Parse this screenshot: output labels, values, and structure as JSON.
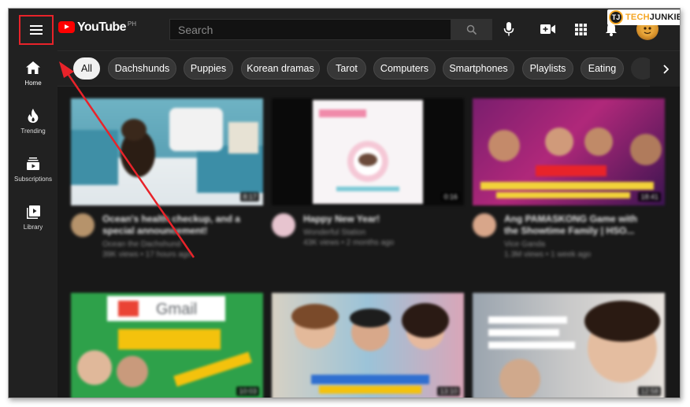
{
  "colors": {
    "accent_red": "#e8232a",
    "youtube_red": "#ff0000",
    "chip_selected_bg": "#f1f1f1",
    "watermark_orange": "#f5a623"
  },
  "header": {
    "logo_text": "YouTube",
    "logo_country": "PH",
    "search_placeholder": "Search",
    "icons": [
      "menu-icon",
      "search-icon",
      "mic-icon",
      "create-video-icon",
      "apps-grid-icon",
      "bell-icon",
      "avatar"
    ]
  },
  "watermark": {
    "badge": "TJ",
    "text_a": "TECH",
    "text_b": "JUNKIE"
  },
  "sidebar": {
    "items": [
      {
        "label": "Home",
        "icon": "home-icon"
      },
      {
        "label": "Trending",
        "icon": "flame-icon"
      },
      {
        "label": "Subscriptions",
        "icon": "subscriptions-icon"
      },
      {
        "label": "Library",
        "icon": "library-icon"
      }
    ]
  },
  "chips": {
    "items": [
      "All",
      "Dachshunds",
      "Puppies",
      "Korean dramas",
      "Tarot",
      "Computers",
      "Smartphones",
      "Playlists",
      "Eating"
    ],
    "selected_index": 0
  },
  "videos": [
    {
      "title_line1": "Ocean's health checkup, and a",
      "title_line2": "special announcement!",
      "channel": "Ocean the Dachshund",
      "stats": "39K views • 17 hours ago",
      "duration": "8:17"
    },
    {
      "title_line1": "Happy New Year!",
      "title_line2": "",
      "channel": "Wonderful Station",
      "stats": "43K views • 2 months ago",
      "duration": "0:16"
    },
    {
      "title_line1": "Ang PAMASKONG Game with",
      "title_line2": "the Showtime Family | HSO...",
      "channel": "Vice Ganda",
      "stats": "1.3M views • 1 week ago",
      "duration": "18:41"
    },
    {
      "title_line1": "",
      "title_line2": "",
      "channel": "",
      "stats": "",
      "duration": "10:03"
    },
    {
      "title_line1": "",
      "title_line2": "",
      "channel": "",
      "stats": "",
      "duration": "13:10"
    },
    {
      "title_line1": "",
      "title_line2": "",
      "channel": "",
      "stats": "",
      "duration": "12:58"
    }
  ],
  "thumb_text": {
    "gmail": "Gmail"
  }
}
